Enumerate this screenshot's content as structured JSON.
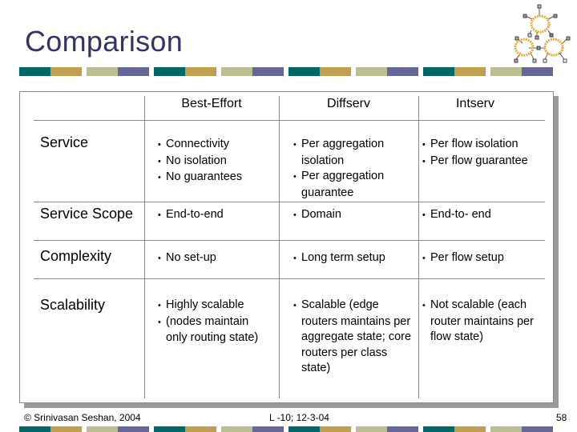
{
  "slide": {
    "title": "Comparison",
    "page_number": "58",
    "footer_left": "© Srinivasan Seshan, 2004",
    "footer_center": "L -10; 12-3-04",
    "logo_icon": "network-rings-icon",
    "colors": {
      "title": "#333366",
      "teal": "#006666",
      "gold": "#C39E4E",
      "sage": "#BCBF95",
      "purple": "#666699",
      "table_border": "#8A8A8A",
      "shadow": "#9A9A9F"
    }
  },
  "table": {
    "columns": [
      "Best-Effort",
      "Diffserv",
      "Intserv"
    ],
    "rows": [
      {
        "label": "Service",
        "cells": [
          [
            "Connectivity",
            "No isolation",
            "No guarantees"
          ],
          [
            "Per aggregation isolation",
            "Per aggregation guarantee"
          ],
          [
            "Per flow isolation",
            "Per flow guarantee"
          ]
        ]
      },
      {
        "label": "Service Scope",
        "cells": [
          [
            "End-to-end"
          ],
          [
            "Domain"
          ],
          [
            "End-to- end"
          ]
        ]
      },
      {
        "label": "Complexity",
        "cells": [
          [
            "No set-up"
          ],
          [
            "Long term setup"
          ],
          [
            "Per flow setup"
          ]
        ]
      },
      {
        "label": "Scalability",
        "cells": [
          [
            "Highly scalable",
            "(nodes maintain only routing state)"
          ],
          [
            "Scalable (edge routers maintains per aggregate state; core routers per class state)"
          ],
          [
            "Not scalable (each router maintains per flow state)"
          ]
        ]
      }
    ]
  }
}
